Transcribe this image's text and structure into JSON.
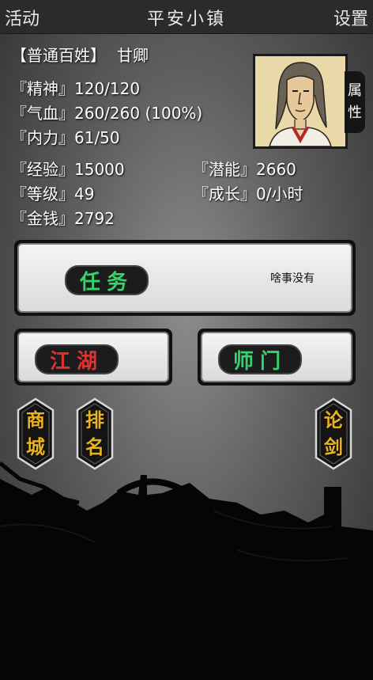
{
  "topbar": {
    "left": "活动",
    "title": "平安小镇",
    "right": "设置"
  },
  "player": {
    "rank": "【普通百姓】",
    "name": "甘卿"
  },
  "stats": {
    "spirit": "『精神』120/120",
    "health": "『气血』260/260 (100%)",
    "inner_power": "『内力』61/50",
    "experience": "『经验』15000",
    "potential": "『潜能』2660",
    "level": "『等级』49",
    "growth": "『成长』0/小时",
    "money": "『金钱』2792"
  },
  "attr_tab": {
    "char1": "属",
    "char2": "性"
  },
  "task": {
    "label": "任务",
    "note": "啥事没有"
  },
  "jianghu": {
    "label": "江湖"
  },
  "shimen": {
    "label": "师门"
  },
  "shop": {
    "c1": "商",
    "c2": "城"
  },
  "ranking": {
    "c1": "排",
    "c2": "名"
  },
  "duel": {
    "c1": "论",
    "c2": "剑"
  },
  "colors": {
    "accent_green": "#34d46a",
    "accent_red": "#e23131",
    "gold": "#e9b320"
  }
}
